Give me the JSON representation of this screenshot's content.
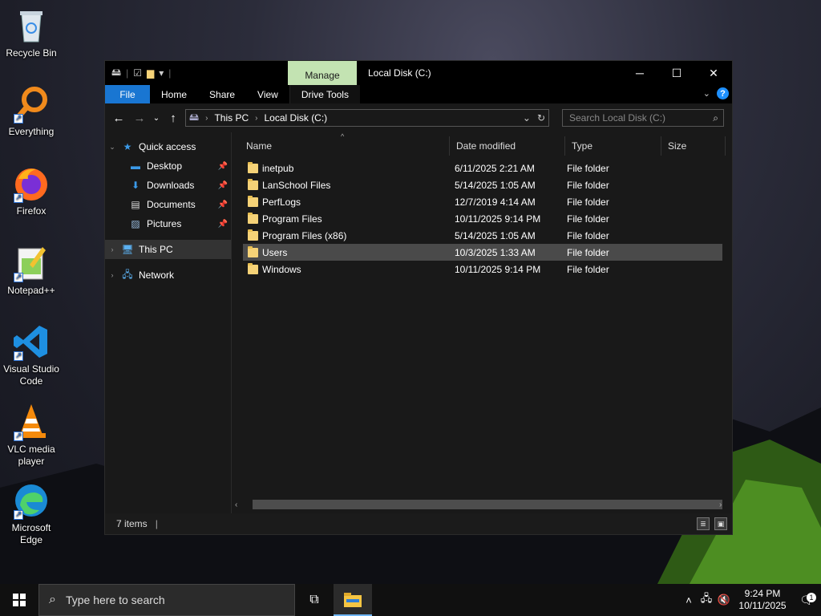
{
  "desktop": {
    "icons": [
      {
        "label": "Recycle Bin",
        "icon": "recycle-bin-icon"
      },
      {
        "label": "Everything",
        "icon": "everything-search-icon"
      },
      {
        "label": "Firefox",
        "icon": "firefox-icon"
      },
      {
        "label": "Notepad++",
        "icon": "notepadpp-icon"
      },
      {
        "label": "Visual Studio Code",
        "icon": "vscode-icon"
      },
      {
        "label": "VLC media player",
        "icon": "vlc-icon"
      },
      {
        "label": "Microsoft Edge",
        "icon": "edge-icon"
      }
    ]
  },
  "window": {
    "title": "Local Disk (C:)",
    "context_tab": "Manage",
    "ribbon_tabs": [
      "File",
      "Home",
      "Share",
      "View",
      "Drive Tools"
    ],
    "address": {
      "crumbs": [
        "This PC",
        "Local Disk (C:)"
      ]
    },
    "search_placeholder": "Search Local Disk (C:)",
    "nav": {
      "quick_access": "Quick access",
      "pinned": [
        "Desktop",
        "Downloads",
        "Documents",
        "Pictures"
      ],
      "this_pc": "This PC",
      "network": "Network"
    },
    "columns": [
      "Name",
      "Date modified",
      "Type",
      "Size"
    ],
    "files": [
      {
        "name": "inetpub",
        "date": "6/11/2025 2:21 AM",
        "type": "File folder"
      },
      {
        "name": "LanSchool Files",
        "date": "5/14/2025 1:05 AM",
        "type": "File folder"
      },
      {
        "name": "PerfLogs",
        "date": "12/7/2019 4:14 AM",
        "type": "File folder"
      },
      {
        "name": "Program Files",
        "date": "10/11/2025 9:14 PM",
        "type": "File folder"
      },
      {
        "name": "Program Files (x86)",
        "date": "5/14/2025 1:05 AM",
        "type": "File folder"
      },
      {
        "name": "Users",
        "date": "10/3/2025 1:33 AM",
        "type": "File folder",
        "selected": true
      },
      {
        "name": "Windows",
        "date": "10/11/2025 9:14 PM",
        "type": "File folder"
      }
    ],
    "status": "7 items"
  },
  "taskbar": {
    "search_placeholder": "Type here to search",
    "time": "9:24 PM",
    "date": "10/11/2025",
    "notifications": "1"
  },
  "colors": {
    "accent": "#1976d2",
    "manage_tab": "#c3e3b2",
    "folder": "#f5d277",
    "selection": "#4a4a4a"
  }
}
